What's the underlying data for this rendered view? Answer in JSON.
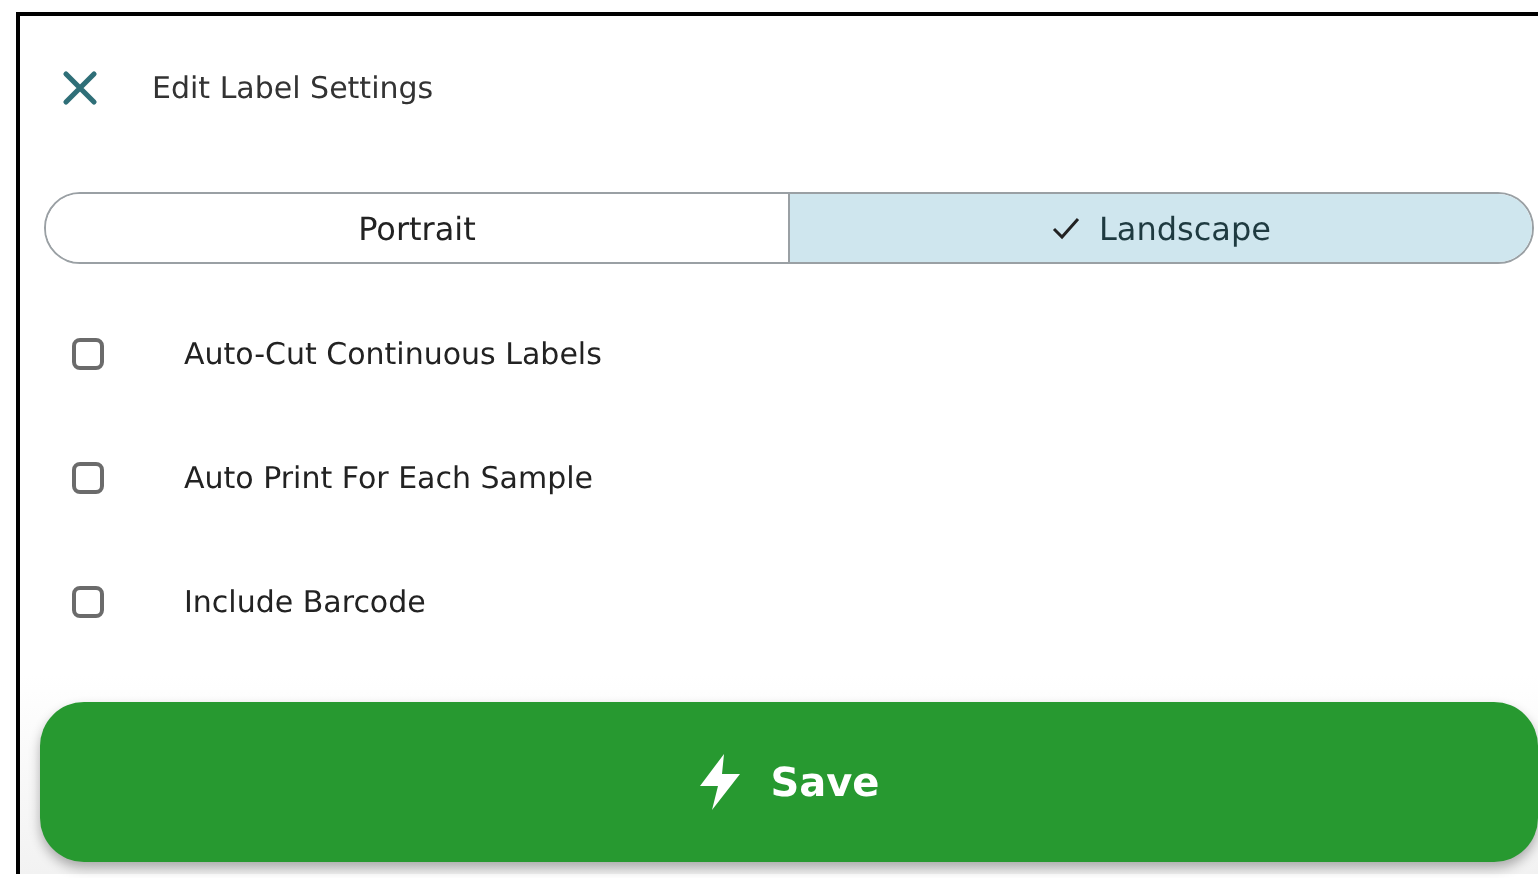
{
  "dialog": {
    "title": "Edit Label Settings"
  },
  "orientation": [
    {
      "label": "Portrait",
      "selected": false
    },
    {
      "label": "Landscape",
      "selected": true
    }
  ],
  "options": [
    {
      "label": "Auto-Cut Continuous Labels",
      "checked": false
    },
    {
      "label": "Auto Print For Each Sample",
      "checked": false
    },
    {
      "label": "Include Barcode",
      "checked": false
    }
  ],
  "save_button": {
    "label": "Save"
  }
}
